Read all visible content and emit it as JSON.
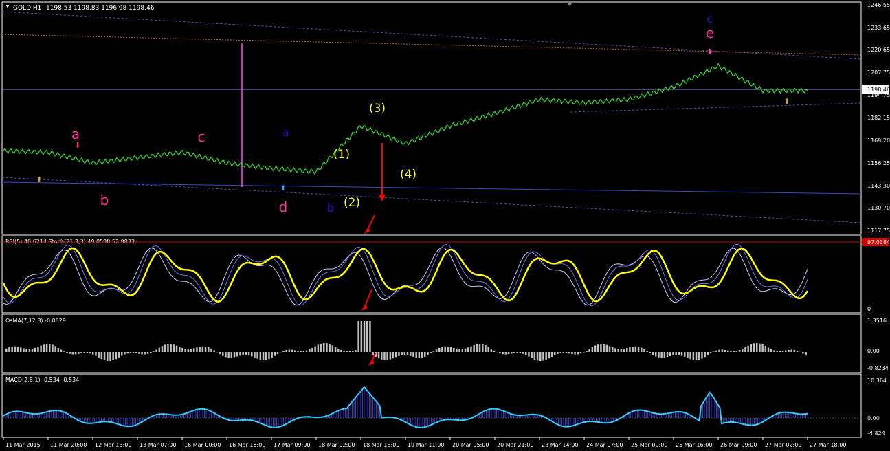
{
  "header": {
    "symbol_label": "GOLD,H1",
    "ohlc": "1198.53 1198.83 1196.98 1198.46"
  },
  "colors": {
    "background": "#000000",
    "grid_border": "#ffffff",
    "candles": "#33cc33",
    "current_price_line": "#8a8ad8",
    "dashed_channel": "#4a5ab8",
    "orange_dotted": "#c8642a",
    "blue_solid_line": "#3a4ac8",
    "magenta_line": "#cc33cc",
    "rsi_yellow": "#ffff00",
    "stoch_main": "#6a7ae0",
    "stoch_signal": "#c8c8ff",
    "osma_bars": "#c0c0c0",
    "macd_line": "#33ccff",
    "macd_hist": "#3a3ab8",
    "red_level": "#cc0000",
    "red_arrow": "#ff0000",
    "label_pink": "#ff3399",
    "label_blue": "#1a1acc",
    "label_yellow": "#ffff33"
  },
  "main_panel": {
    "price_axis": [
      "1246.55",
      "1233.65",
      "1220.65",
      "1207.75",
      "1194.75",
      "1182.15",
      "1169.20",
      "1156.25",
      "1143.30",
      "1130.70",
      "1117.75"
    ],
    "current_price": "1198.46",
    "labels": [
      {
        "text": "a",
        "color": "pink"
      },
      {
        "text": "b",
        "color": "pink"
      },
      {
        "text": "c",
        "color": "pink"
      },
      {
        "text": "a",
        "color": "blue"
      },
      {
        "text": "d",
        "color": "pink"
      },
      {
        "text": "b",
        "color": "blue"
      },
      {
        "text": "(1)",
        "color": "yellow"
      },
      {
        "text": "(2)",
        "color": "yellow"
      },
      {
        "text": "(3)",
        "color": "yellow"
      },
      {
        "text": "(4)",
        "color": "yellow"
      },
      {
        "text": "c",
        "color": "blue"
      },
      {
        "text": "e",
        "color": "pink"
      }
    ]
  },
  "rsi_panel": {
    "title": "RSI(5) 40.6214  Stoch(21,3,3) 49.0598 52.9833",
    "level_value": "97.0384",
    "bottom_value": "0"
  },
  "osma_panel": {
    "title": "OsMA(7,12,3) -0.0629",
    "axis": [
      "1.3516",
      "0.00",
      "-0.8234"
    ]
  },
  "macd_panel": {
    "title": "MACD(2,8,1) -0.534 -0.534",
    "axis": [
      "10.364",
      "0.00",
      "-4.824"
    ]
  },
  "time_axis": [
    "11 Mar 2015",
    "11 Mar 20:00",
    "12 Mar 13:00",
    "13 Mar 07:00",
    "16 Mar 00:00",
    "16 Mar 16:00",
    "17 Mar 09:00",
    "18 Mar 02:00",
    "18 Mar 18:00",
    "19 Mar 11:00",
    "20 Mar 05:00",
    "20 Mar 21:00",
    "23 Mar 14:00",
    "24 Mar 07:00",
    "25 Mar 00:00",
    "25 Mar 16:00",
    "26 Mar 09:00",
    "27 Mar 02:00",
    "27 Mar 18:00"
  ],
  "chart_data": {
    "type": "line",
    "symbol": "GOLD,H1",
    "candles": "green",
    "y_range": [
      1117.75,
      1246.55
    ],
    "x": [
      "11 Mar 2015",
      "11 Mar 20:00",
      "12 Mar 13:00",
      "13 Mar 07:00",
      "16 Mar 00:00",
      "16 Mar 16:00",
      "17 Mar 09:00",
      "18 Mar 02:00",
      "18 Mar 18:00",
      "19 Mar 11:00",
      "20 Mar 05:00",
      "20 Mar 21:00",
      "23 Mar 14:00",
      "24 Mar 07:00",
      "25 Mar 00:00",
      "25 Mar 16:00",
      "26 Mar 09:00",
      "27 Mar 02:00",
      "27 Mar 18:00"
    ],
    "series": [
      {
        "name": "GOLD,H1",
        "values": [
          1164,
          1163,
          1157,
          1160,
          1163,
          1157,
          1154,
          1152,
          1178,
          1168,
          1178,
          1185,
          1193,
          1191,
          1193,
          1200,
          1212,
          1198,
          1198
        ]
      }
    ]
  }
}
